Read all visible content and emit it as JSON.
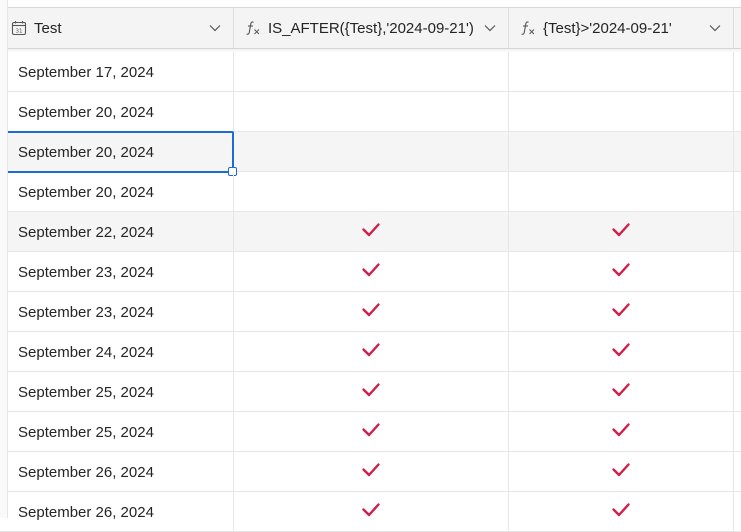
{
  "columns": [
    {
      "label": "Test",
      "icon": "calendar-icon"
    },
    {
      "label": "IS_AFTER({Test},'2024-09-21')",
      "icon": "formula-icon"
    },
    {
      "label": "{Test}>'2024-09-21'",
      "icon": "formula-icon"
    }
  ],
  "rows": [
    {
      "date": "September 17, 2024",
      "is_after": false,
      "greater": false
    },
    {
      "date": "September 20, 2024",
      "is_after": false,
      "greater": false
    },
    {
      "date": "September 20, 2024",
      "is_after": false,
      "greater": false,
      "selected": true
    },
    {
      "date": "September 20, 2024",
      "is_after": false,
      "greater": false
    },
    {
      "date": "September 22, 2024",
      "is_after": true,
      "greater": true
    },
    {
      "date": "September 23, 2024",
      "is_after": true,
      "greater": true
    },
    {
      "date": "September 23, 2024",
      "is_after": true,
      "greater": true
    },
    {
      "date": "September 24, 2024",
      "is_after": true,
      "greater": true
    },
    {
      "date": "September 25, 2024",
      "is_after": true,
      "greater": true
    },
    {
      "date": "September 25, 2024",
      "is_after": true,
      "greater": true
    },
    {
      "date": "September 26, 2024",
      "is_after": true,
      "greater": true
    },
    {
      "date": "September 26, 2024",
      "is_after": true,
      "greater": true
    }
  ],
  "colors": {
    "check": "#d11f4a",
    "selection": "#1c6bd6"
  }
}
